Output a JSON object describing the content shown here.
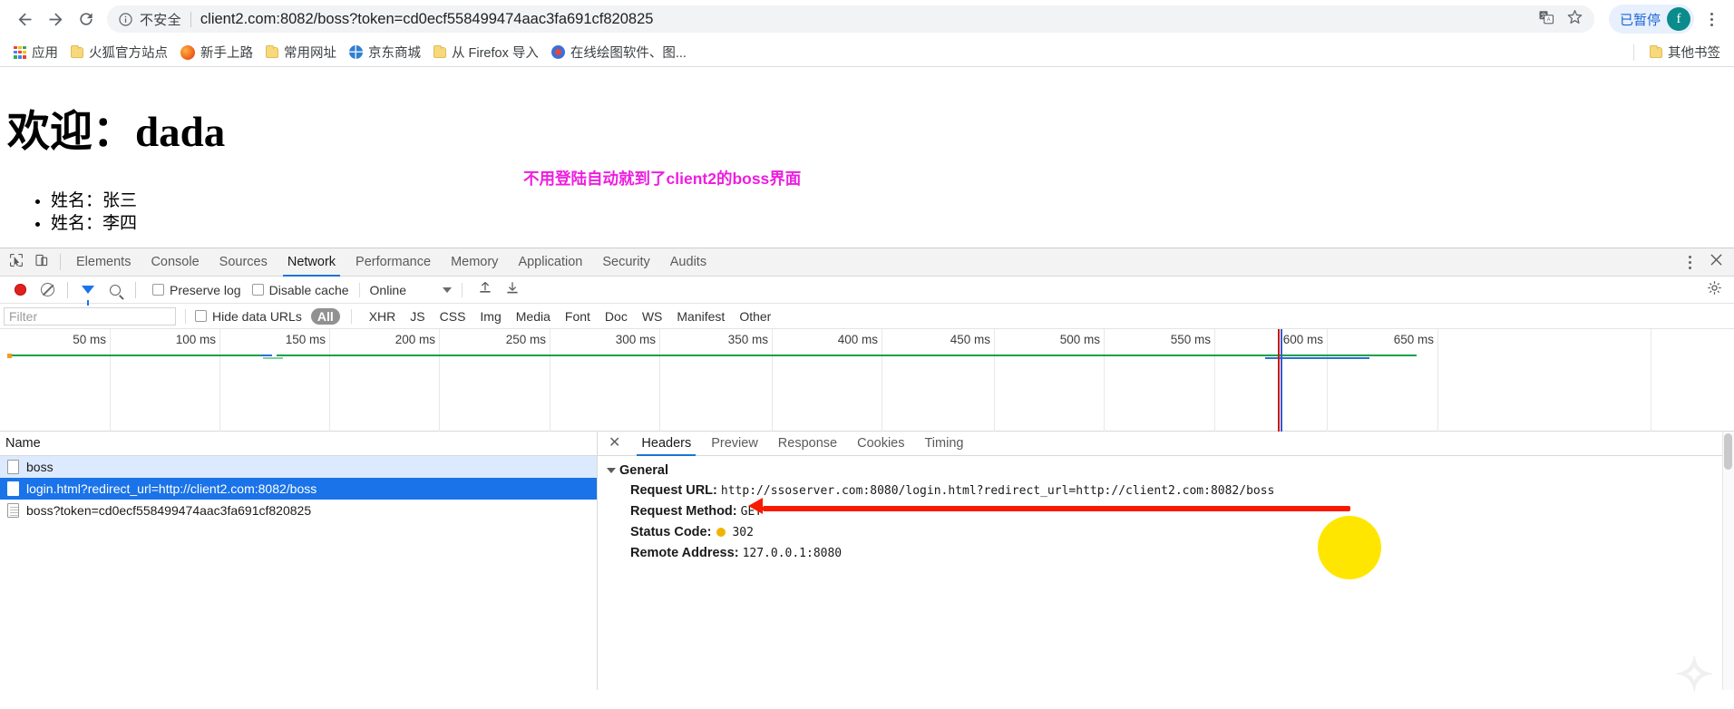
{
  "browser": {
    "back_icon": "back-arrow-icon",
    "forward_icon": "forward-arrow-icon",
    "reload_icon": "reload-icon",
    "security_label": "不安全",
    "url_host": "client2.com:8082",
    "url_path": "/boss?token=cd0ecf558499474aac3fa691cf820825",
    "url_full": "client2.com:8082/boss?token=cd0ecf558499474aac3fa691cf820825",
    "translate_icon": "translate-icon",
    "bookmark_icon": "star-icon",
    "profile_status": "已暂停",
    "profile_initial": "f",
    "menu_icon": "kebab-menu-icon"
  },
  "bookmarks": {
    "apps_label": "应用",
    "items": [
      {
        "label": "火狐官方站点",
        "icon": "folder-icon"
      },
      {
        "label": "新手上路",
        "icon": "firefox-icon"
      },
      {
        "label": "常用网址",
        "icon": "folder-icon"
      },
      {
        "label": "京东商城",
        "icon": "globe-icon"
      },
      {
        "label": "从 Firefox 导入",
        "icon": "folder-icon"
      },
      {
        "label": "在线绘图软件、图...",
        "icon": "drawing-icon"
      }
    ],
    "other_label": "其他书签",
    "other_icon": "folder-icon"
  },
  "page": {
    "heading": "欢迎：dada",
    "list": [
      "姓名：张三",
      "姓名：李四"
    ],
    "annotation": "不用登陆自动就到了client2的boss界面",
    "annotation_color": "#ee1ee0"
  },
  "devtools": {
    "inspect_icon": "inspect-element-icon",
    "device_icon": "device-toolbar-icon",
    "tabs": [
      "Elements",
      "Console",
      "Sources",
      "Network",
      "Performance",
      "Memory",
      "Application",
      "Security",
      "Audits"
    ],
    "active_tab": "Network",
    "more_icon": "kebab-menu-icon",
    "close_icon": "close-icon",
    "toolbar": {
      "record_icon": "record-button-icon",
      "clear_icon": "clear-icon",
      "filter_icon": "filter-funnel-icon",
      "search_icon": "search-icon",
      "preserve_log": "Preserve log",
      "disable_cache": "Disable cache",
      "throttling": "Online",
      "import_icon": "import-har-icon",
      "export_icon": "export-har-icon",
      "settings_icon": "gear-icon"
    },
    "filterbar": {
      "placeholder": "Filter",
      "hide_data_urls": "Hide data URLs",
      "types": [
        "All",
        "XHR",
        "JS",
        "CSS",
        "Img",
        "Media",
        "Font",
        "Doc",
        "WS",
        "Manifest",
        "Other"
      ],
      "active_type": "All"
    },
    "timeline": {
      "ticks": [
        "50 ms",
        "100 ms",
        "150 ms",
        "200 ms",
        "250 ms",
        "300 ms",
        "350 ms",
        "400 ms",
        "450 ms",
        "500 ms",
        "550 ms",
        "600 ms",
        "650 ms"
      ]
    },
    "requests": {
      "column_header": "Name",
      "rows": [
        {
          "name": "boss",
          "state": "alt",
          "icon": "document-icon"
        },
        {
          "name": "login.html?redirect_url=http://client2.com:8082/boss",
          "state": "selected",
          "icon": "document-icon"
        },
        {
          "name": "boss?token=cd0ecf558499474aac3fa691cf820825",
          "state": "normal",
          "icon": "document-lines-icon"
        }
      ]
    },
    "detail": {
      "tabs": [
        "Headers",
        "Preview",
        "Response",
        "Cookies",
        "Timing"
      ],
      "active_tab": "Headers",
      "section_title": "General",
      "fields": [
        {
          "key": "Request URL:",
          "value": "http://ssoserver.com:8080/login.html?redirect_url=http://client2.com:8082/boss"
        },
        {
          "key": "Request Method:",
          "value": "GET"
        },
        {
          "key": "Status Code:",
          "value": "302",
          "dot": "#f0b400"
        },
        {
          "key": "Remote Address:",
          "value": "127.0.0.1:8080"
        }
      ]
    }
  },
  "annotations": {
    "red_line_color": "#f61b00",
    "yellow_circle_color": "#ffe600"
  }
}
